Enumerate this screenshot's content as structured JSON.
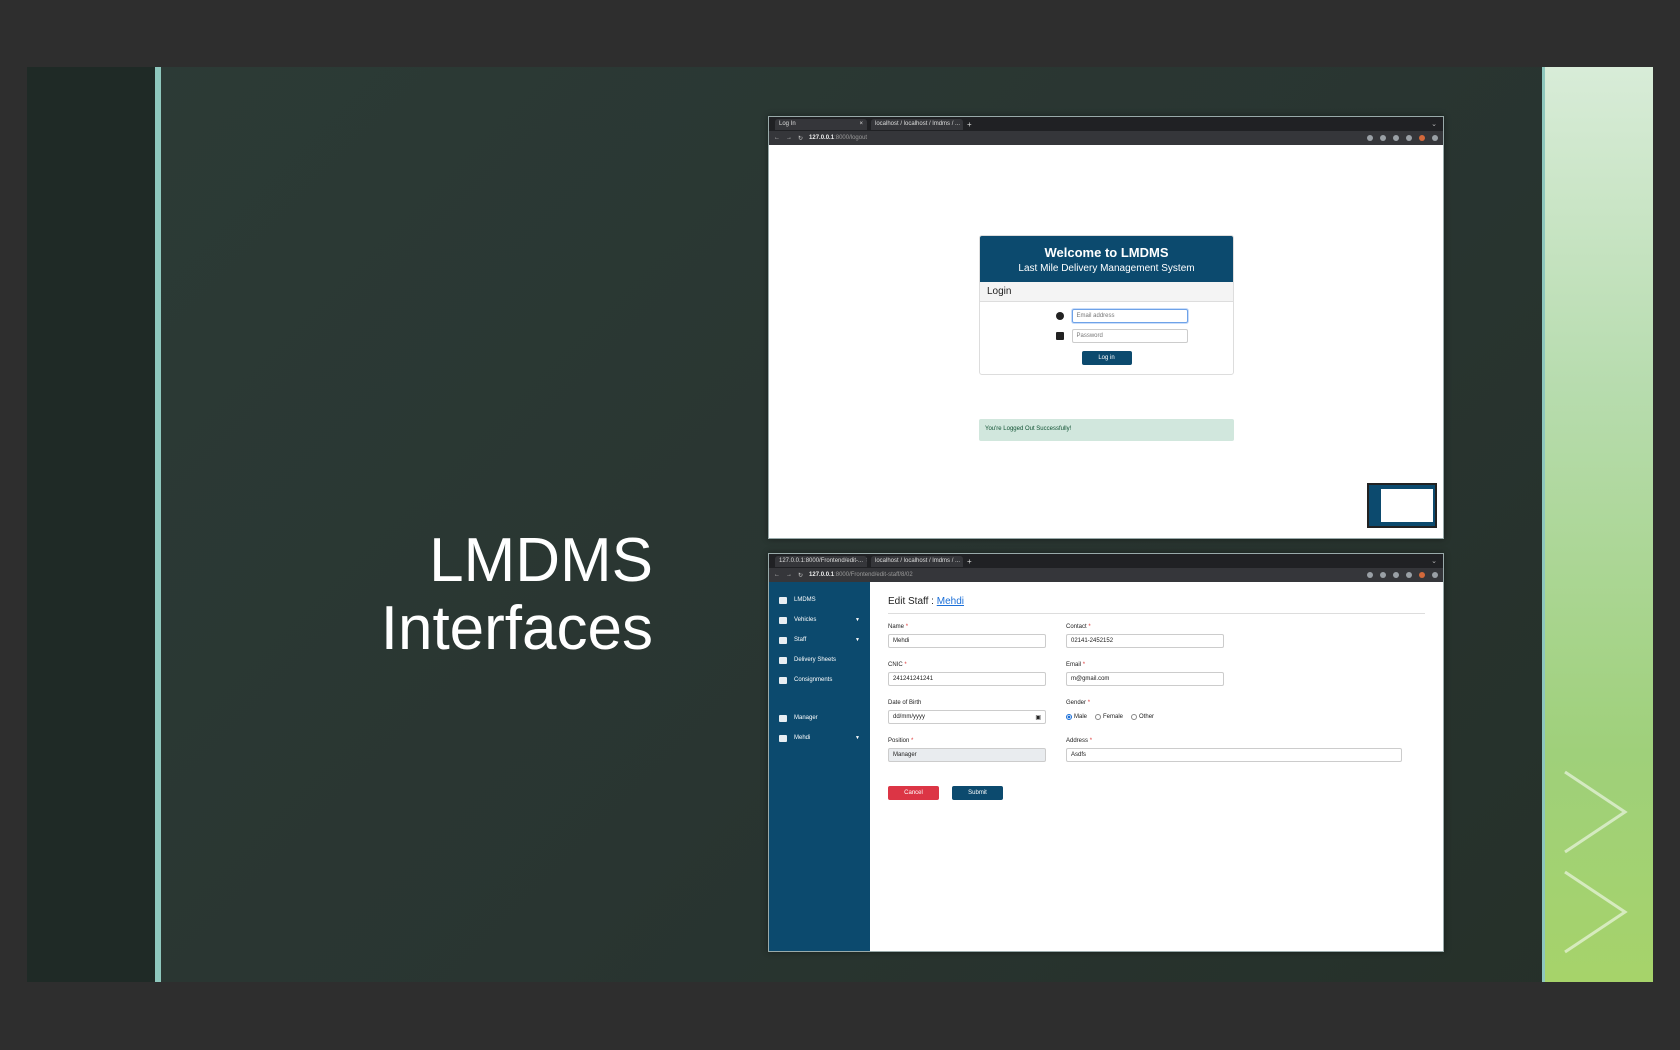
{
  "slide": {
    "title_line1": "LMDMS",
    "title_line2": "Interfaces"
  },
  "login_screenshot": {
    "tabs": [
      {
        "label": "Log In",
        "close": "×"
      },
      {
        "label": "localhost / localhost / lmdms / ...",
        "close": "×"
      }
    ],
    "new_tab": "+",
    "url_host": "127.0.0.1",
    "url_path": ":8000/logout",
    "card_title": "Welcome to LMDMS",
    "card_subtitle": "Last Mile Delivery Management System",
    "section_label": "Login",
    "email_placeholder": "Email address",
    "password_placeholder": "Password",
    "login_button": "Log in",
    "alert_text": "You're Logged Out Successfully!"
  },
  "staff_screenshot": {
    "tabs": [
      {
        "label": "127.0.0.1:8000/Frontend/edit-...",
        "close": "×"
      },
      {
        "label": "localhost / localhost / lmdms / ...",
        "close": "×"
      }
    ],
    "new_tab": "+",
    "url_host": "127.0.0.1",
    "url_path": ":8000/Frontend/edit-staff/8/02",
    "sidebar": {
      "items": [
        {
          "label": "LMDMS",
          "chevron": ""
        },
        {
          "label": "Vehicles",
          "chevron": "▼"
        },
        {
          "label": "Staff",
          "chevron": "▼"
        },
        {
          "label": "Delivery Sheets",
          "chevron": ""
        },
        {
          "label": "Consignments",
          "chevron": ""
        }
      ],
      "bottom_items": [
        {
          "label": "Manager",
          "chevron": ""
        },
        {
          "label": "Mehdi",
          "chevron": "▼"
        }
      ]
    },
    "page_title_prefix": "Edit Staff : ",
    "page_title_link": "Mehdi",
    "required_mark": "*",
    "fields": {
      "name_label": "Name",
      "name_value": "Mehdi",
      "contact_label": "Contact",
      "contact_value": "02141-2452152",
      "cnic_label": "CNIC",
      "cnic_value": "241241241241",
      "email_label": "Email",
      "email_value": "m@gmail.com",
      "dob_label": "Date of Birth",
      "dob_value": "dd/mm/yyyy",
      "gender_label": "Gender",
      "gender_options": [
        "Male",
        "Female",
        "Other"
      ],
      "gender_selected": "Male",
      "position_label": "Position",
      "position_value": "Manager",
      "address_label": "Address",
      "address_value": "Asdfs"
    },
    "cancel_button": "Cancel",
    "submit_button": "Submit"
  },
  "colors": {
    "brand_blue": "#0c4a6e",
    "cancel_red": "#dc3545",
    "alert_green_bg": "#d1e7dd",
    "accent_teal": "#8ec7bd"
  },
  "icons": {
    "user": "user-circle-icon",
    "lock": "lock-icon",
    "home": "home-icon",
    "truck": "truck-icon",
    "users": "users-icon",
    "file": "file-icon",
    "boxes": "boxes-icon",
    "calendar": "calendar-icon"
  }
}
